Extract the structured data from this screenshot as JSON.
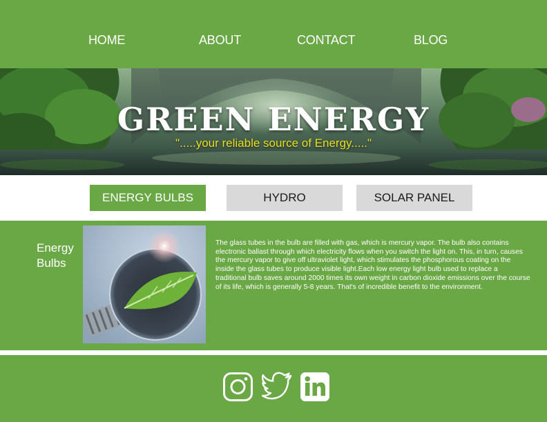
{
  "nav": {
    "items": [
      {
        "label": "HOME"
      },
      {
        "label": "ABOUT"
      },
      {
        "label": "CONTACT"
      },
      {
        "label": "BLOG"
      }
    ]
  },
  "hero": {
    "title": "GREEN ENERGY",
    "tagline": "\".....your reliable source of Energy.....\""
  },
  "tabs": [
    {
      "label": "ENERGY BULBS",
      "active": true
    },
    {
      "label": "HYDRO",
      "active": false
    },
    {
      "label": "SOLAR PANEL",
      "active": false
    }
  ],
  "content": {
    "heading": "Energy Bulbs",
    "body": "The glass tubes in the bulb are filled with gas, which is mercury vapor. The bulb also contains electronic ballast through which electricity flows when you switch the light on. This, in turn, causes the mercury vapor to give off ultraviolet light, which stimulates the phosphorous coating on the inside the glass tubes to produce visible light.Each low energy light bulb used to replace a traditional bulb saves around 2000 times its own weight in carbon dioxide emissions over the course of its life, which is generally 5-8 years. That's of incredible benefit to the environment."
  },
  "footer": {
    "social_icons": [
      "instagram-icon",
      "twitter-icon",
      "linkedin-icon"
    ]
  },
  "colors": {
    "brand_green": "#6aa845",
    "tab_inactive": "#d9d9d9",
    "tagline_yellow": "#e8e020"
  }
}
